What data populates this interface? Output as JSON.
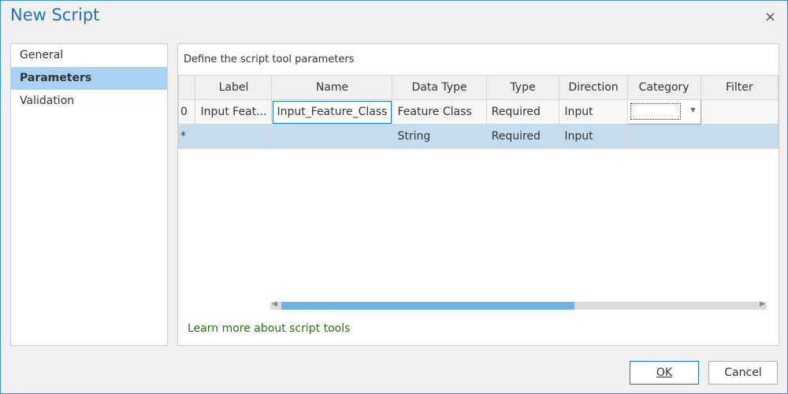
{
  "window": {
    "title": "New Script",
    "close": "×"
  },
  "sidebar": {
    "items": [
      {
        "label": "General"
      },
      {
        "label": "Parameters"
      },
      {
        "label": "Validation"
      }
    ],
    "selected": "Parameters"
  },
  "main": {
    "caption": "Define the script tool parameters",
    "columns": [
      "",
      "Label",
      "Name",
      "Data Type",
      "Type",
      "Direction",
      "Category",
      "Filter"
    ],
    "rows": [
      [
        "0",
        "Input Feat...",
        "Input_Feature_Class",
        "Feature Class",
        "Required",
        "Input",
        "",
        ""
      ],
      [
        "*",
        "",
        "",
        "String",
        "Required",
        "Input",
        "",
        ""
      ]
    ],
    "scroll_fraction": 0.62,
    "link": "Learn more about script tools"
  },
  "buttons": {
    "ok": "OK",
    "cancel": "Cancel"
  }
}
